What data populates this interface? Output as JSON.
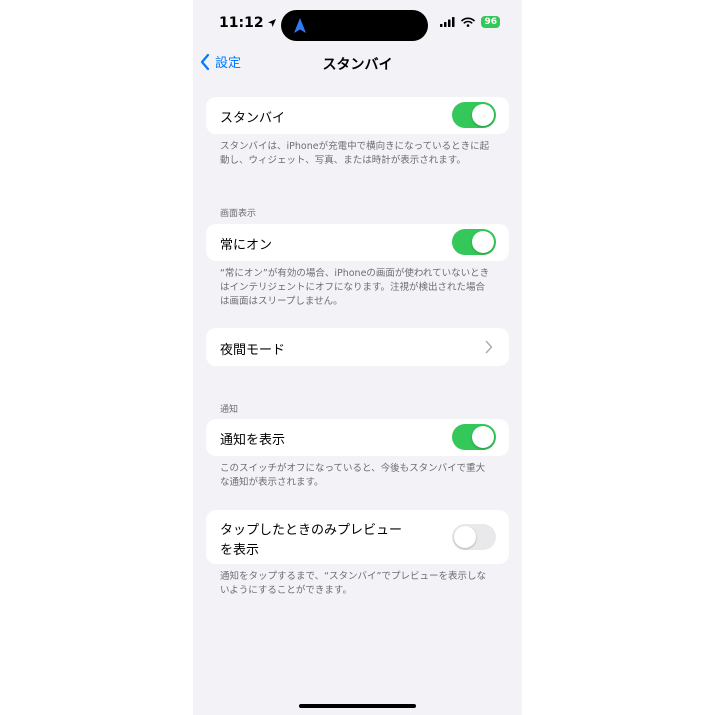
{
  "status_bar": {
    "time": "11:12",
    "battery": "96"
  },
  "nav": {
    "back_label": "設定",
    "title": "スタンバイ"
  },
  "standby": {
    "label": "スタンバイ",
    "on": true,
    "footer": "スタンバイは、iPhoneが充電中で横向きになっているときに起動し、ウィジェット、写真、または時計が表示されます。"
  },
  "display_section": {
    "header": "画面表示",
    "always_on": {
      "label": "常にオン",
      "on": true,
      "footer": "“常にオン”が有効の場合、iPhoneの画面が使われていないときはインテリジェントにオフになります。注視が検出された場合は画面はスリープしません。"
    },
    "night_mode": {
      "label": "夜間モード"
    }
  },
  "notifications_section": {
    "header": "通知",
    "show_notifications": {
      "label": "通知を表示",
      "on": true,
      "footer": "このスイッチがオフになっていると、今後もスタンバイで重大な通知が表示されます。"
    },
    "preview_on_tap": {
      "label_line1": "タップしたときのみプレビュー",
      "label_line2": "を表示",
      "on": false,
      "footer": "通知をタップするまで、“スタンバイ”でプレビューを表示しないようにすることができます。"
    }
  },
  "colors": {
    "accent": "#007aff",
    "toggle_on": "#34c759",
    "background": "#f2f2f7"
  }
}
